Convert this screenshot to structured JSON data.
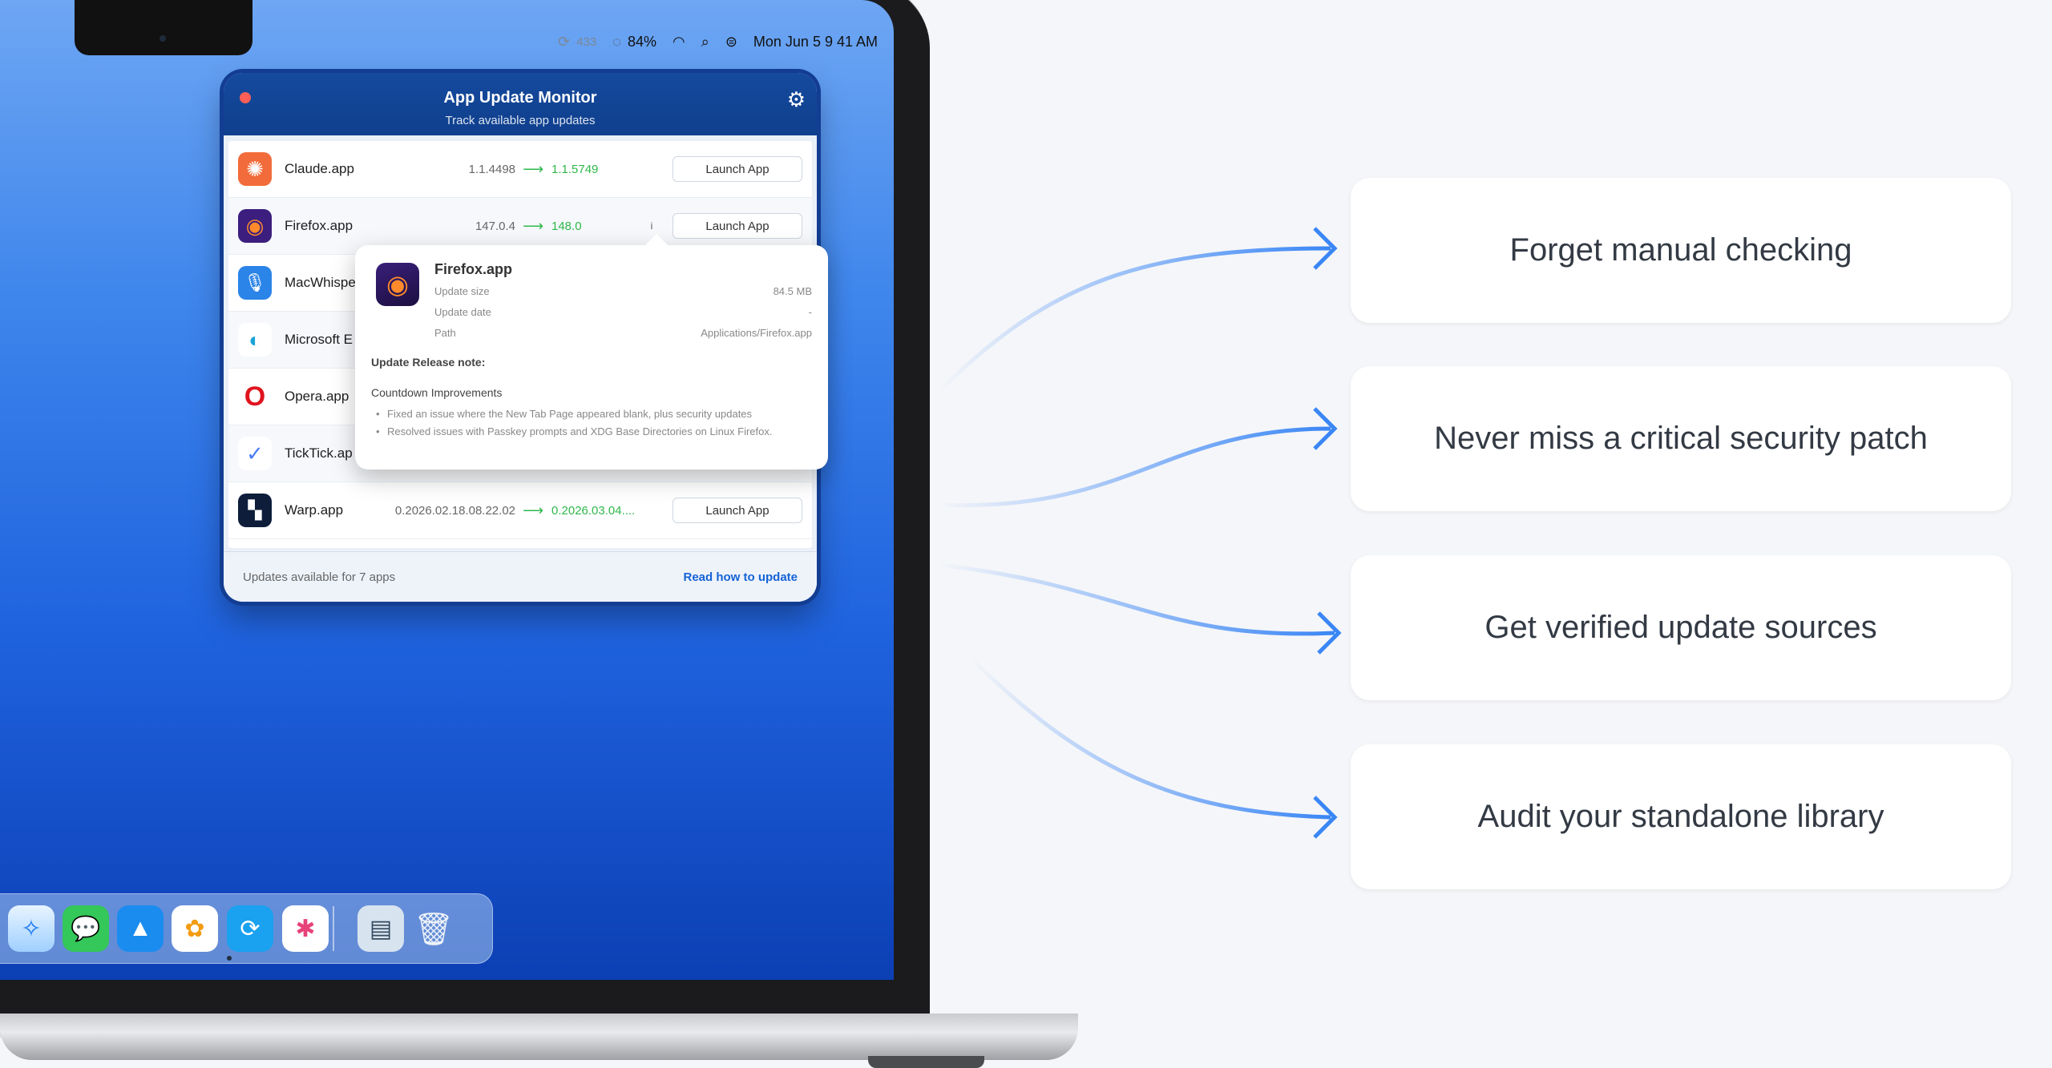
{
  "menubar": {
    "sync_count": "433",
    "battery": "84%",
    "datetime": "Mon Jun 5  9 41 AM"
  },
  "app": {
    "title": "App Update Monitor",
    "subtitle": "Track available app updates",
    "rows": [
      {
        "name": "Claude.app",
        "old": "1.1.4498",
        "new": "1.1.5749",
        "launch": "Launch App",
        "color": "#f26b3a",
        "glyph": "✺"
      },
      {
        "name": "Firefox.app",
        "old": "147.0.4",
        "new": "148.0",
        "launch": "Launch App",
        "color": "#3b1e7e",
        "glyph": "◉"
      },
      {
        "name": "MacWhispe",
        "color": "#2b84e8",
        "glyph": "🎙"
      },
      {
        "name": "Microsoft E",
        "color": "#ffffff",
        "glyph": "◐"
      },
      {
        "name": "Opera.app",
        "color": "#ffffff",
        "glyph": "O"
      },
      {
        "name": "TickTick.ap",
        "color": "#ffffff",
        "glyph": "✓"
      },
      {
        "name": "Warp.app",
        "old": "0.2026.02.18.08.22.02",
        "new": "0.2026.03.04....",
        "launch": "Launch App",
        "color": "#0d1d3a",
        "glyph": "▚"
      }
    ],
    "footer_status": "Updates available for 7 apps",
    "footer_link": "Read how to update"
  },
  "popover": {
    "title": "Firefox.app",
    "size_label": "Update size",
    "size_value": "84.5 MB",
    "date_label": "Update date",
    "date_value": "-",
    "path_label": "Path",
    "path_value": "Applications/Firefox.app",
    "release_note_heading": "Update Release note:",
    "section": "Countdown Improvements",
    "bullets": [
      "Fixed an issue where the New Tab Page appeared blank, plus security updates",
      "Resolved issues with Passkey prompts and XDG Base Directories on Linux Firefox."
    ]
  },
  "features": [
    "Forget manual checking",
    "Never miss a critical security patch",
    "Get verified update sources",
    "Audit your standalone library"
  ]
}
